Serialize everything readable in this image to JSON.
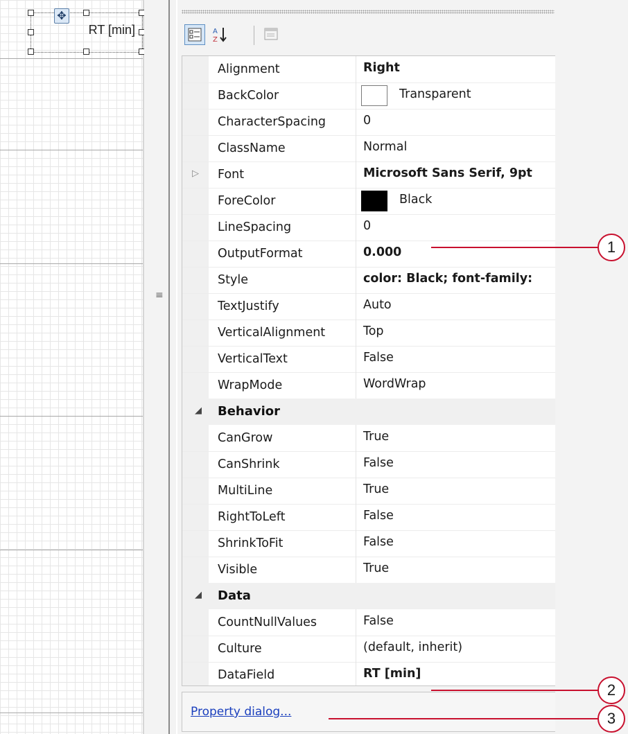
{
  "designer": {
    "textbox_text": "RT [min]"
  },
  "toolbar": {
    "categorized_icon": "categorized-view-icon",
    "alphabetical_icon": "sort-alphabetical-icon",
    "property_pages_icon": "property-pages-icon"
  },
  "properties": {
    "appearance": [
      {
        "name": "Alignment",
        "value": "Right",
        "bold": true
      },
      {
        "name": "BackColor",
        "value": "Transparent",
        "swatch": "#ffffff"
      },
      {
        "name": "CharacterSpacing",
        "value": "0"
      },
      {
        "name": "ClassName",
        "value": "Normal"
      },
      {
        "name": "Font",
        "value": "Microsoft Sans Serif, 9pt",
        "bold": true,
        "expandable": true
      },
      {
        "name": "ForeColor",
        "value": "Black",
        "swatch": "#000000"
      },
      {
        "name": "LineSpacing",
        "value": "0"
      },
      {
        "name": "OutputFormat",
        "value": "0.000",
        "bold": true
      },
      {
        "name": "Style",
        "value": "color: Black; font-family:",
        "bold": true
      },
      {
        "name": "TextJustify",
        "value": "Auto"
      },
      {
        "name": "VerticalAlignment",
        "value": "Top"
      },
      {
        "name": "VerticalText",
        "value": "False"
      },
      {
        "name": "WrapMode",
        "value": "WordWrap"
      }
    ],
    "behavior": {
      "label": "Behavior",
      "items": [
        {
          "name": "CanGrow",
          "value": "True"
        },
        {
          "name": "CanShrink",
          "value": "False"
        },
        {
          "name": "MultiLine",
          "value": "True"
        },
        {
          "name": "RightToLeft",
          "value": "False"
        },
        {
          "name": "ShrinkToFit",
          "value": "False"
        },
        {
          "name": "Visible",
          "value": "True"
        }
      ]
    },
    "data": {
      "label": "Data",
      "items": [
        {
          "name": "CountNullValues",
          "value": "False"
        },
        {
          "name": "Culture",
          "value": "(default, inherit)"
        },
        {
          "name": "DataField",
          "value": "RT [min]",
          "bold": true
        }
      ]
    }
  },
  "commands": {
    "property_dialog_link": "Property dialog..."
  },
  "callouts": {
    "one": "1",
    "two": "2",
    "three": "3",
    "color": "#c8102e"
  }
}
